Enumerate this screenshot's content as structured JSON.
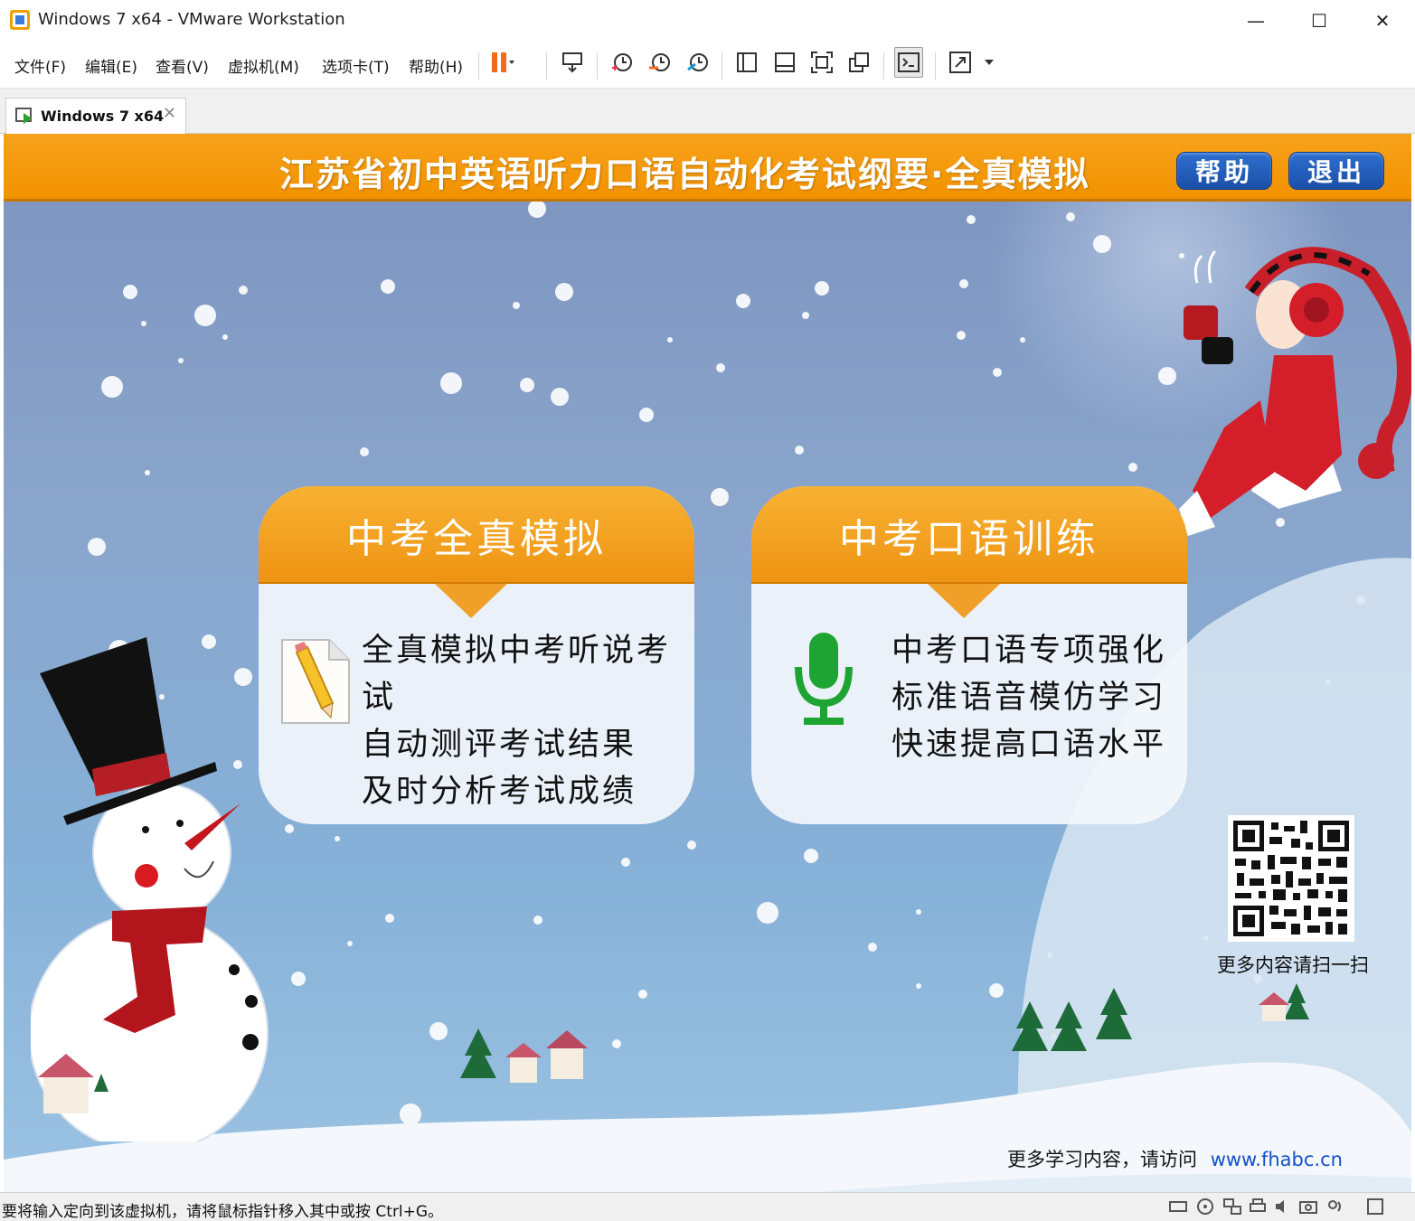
{
  "window": {
    "title": "Windows 7 x64 - VMware Workstation",
    "minimize": "—",
    "maximize": "☐",
    "close": "✕"
  },
  "menu": [
    "文件(F)",
    "编辑(E)",
    "查看(V)",
    "虚拟机(M)",
    "选项卡(T)",
    "帮助(H)"
  ],
  "tab": {
    "label": "Windows 7 x64",
    "close": "✕"
  },
  "app": {
    "title": "江苏省初中英语听力口语自动化考试纲要·全真模拟",
    "help_button": "帮助",
    "exit_button": "退出",
    "colors": {
      "header": "#f29200",
      "button": "#1b4fa8",
      "card_head": "#ee9312"
    }
  },
  "cards": [
    {
      "title": "中考全真模拟",
      "icon": "pencil-document-icon",
      "lines": [
        "全真模拟中考听说考试",
        "自动测评考试结果",
        "及时分析考试成绩"
      ]
    },
    {
      "title": "中考口语训练",
      "icon": "microphone-icon",
      "lines": [
        "中考口语专项强化",
        "标准语音模仿学习",
        "快速提高口语水平"
      ]
    }
  ],
  "qr": {
    "label": "更多内容请扫一扫"
  },
  "footer": {
    "text": "更多学习内容，请访问",
    "link": "www.fhabc.cn"
  },
  "status": {
    "text": "要将输入定向到该虚拟机，请将鼠标指针移入其中或按 Ctrl+G。"
  }
}
